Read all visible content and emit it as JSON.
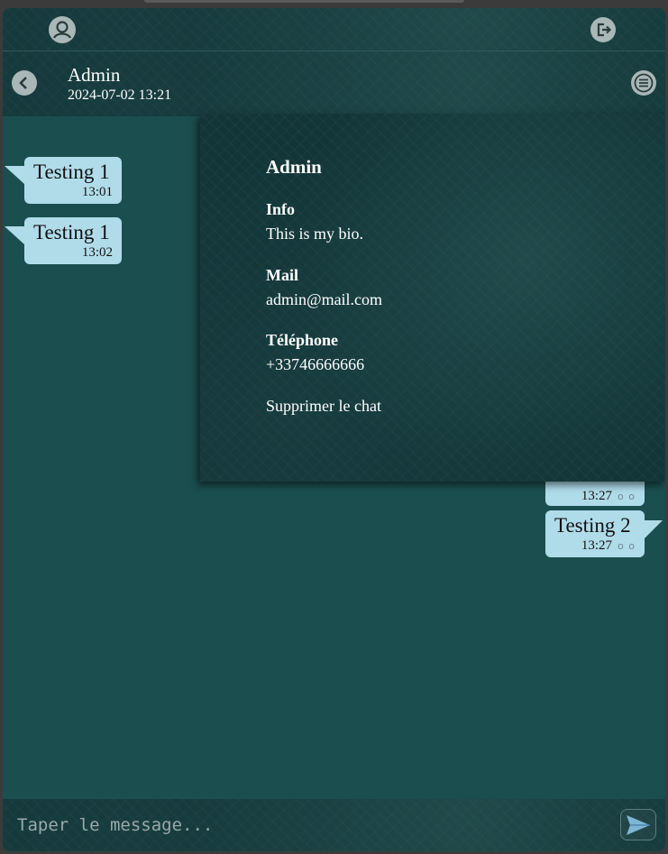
{
  "header": {
    "contact_name": "Admin",
    "last_seen": "2024-07-02 13:21"
  },
  "icons": {
    "profile": "user-circle-icon",
    "logout": "logout-icon",
    "back": "chevron-left-icon",
    "menu": "menu-icon",
    "send": "send-icon"
  },
  "messages": [
    {
      "direction": "incoming",
      "text": "Testing 1",
      "time": "13:01"
    },
    {
      "direction": "incoming",
      "text": "Testing 1",
      "time": "13:02"
    },
    {
      "direction": "outgoing",
      "text": "",
      "time": "13:27",
      "ticks": "o o"
    },
    {
      "direction": "outgoing",
      "text": "Testing 2",
      "time": "13:27",
      "ticks": "o o"
    }
  ],
  "profile_panel": {
    "title": "Admin",
    "info_label": "Info",
    "info_value": "This is my bio.",
    "mail_label": "Mail",
    "mail_value": "admin@mail.com",
    "phone_label": "Téléphone",
    "phone_value": "+33746666666",
    "delete_chat": "Supprimer le chat"
  },
  "composer": {
    "placeholder": "Taper le message..."
  },
  "colors": {
    "bubble": "#b0dcea",
    "chat_bg": "#1b4e4f",
    "header_bg": "#123638"
  }
}
